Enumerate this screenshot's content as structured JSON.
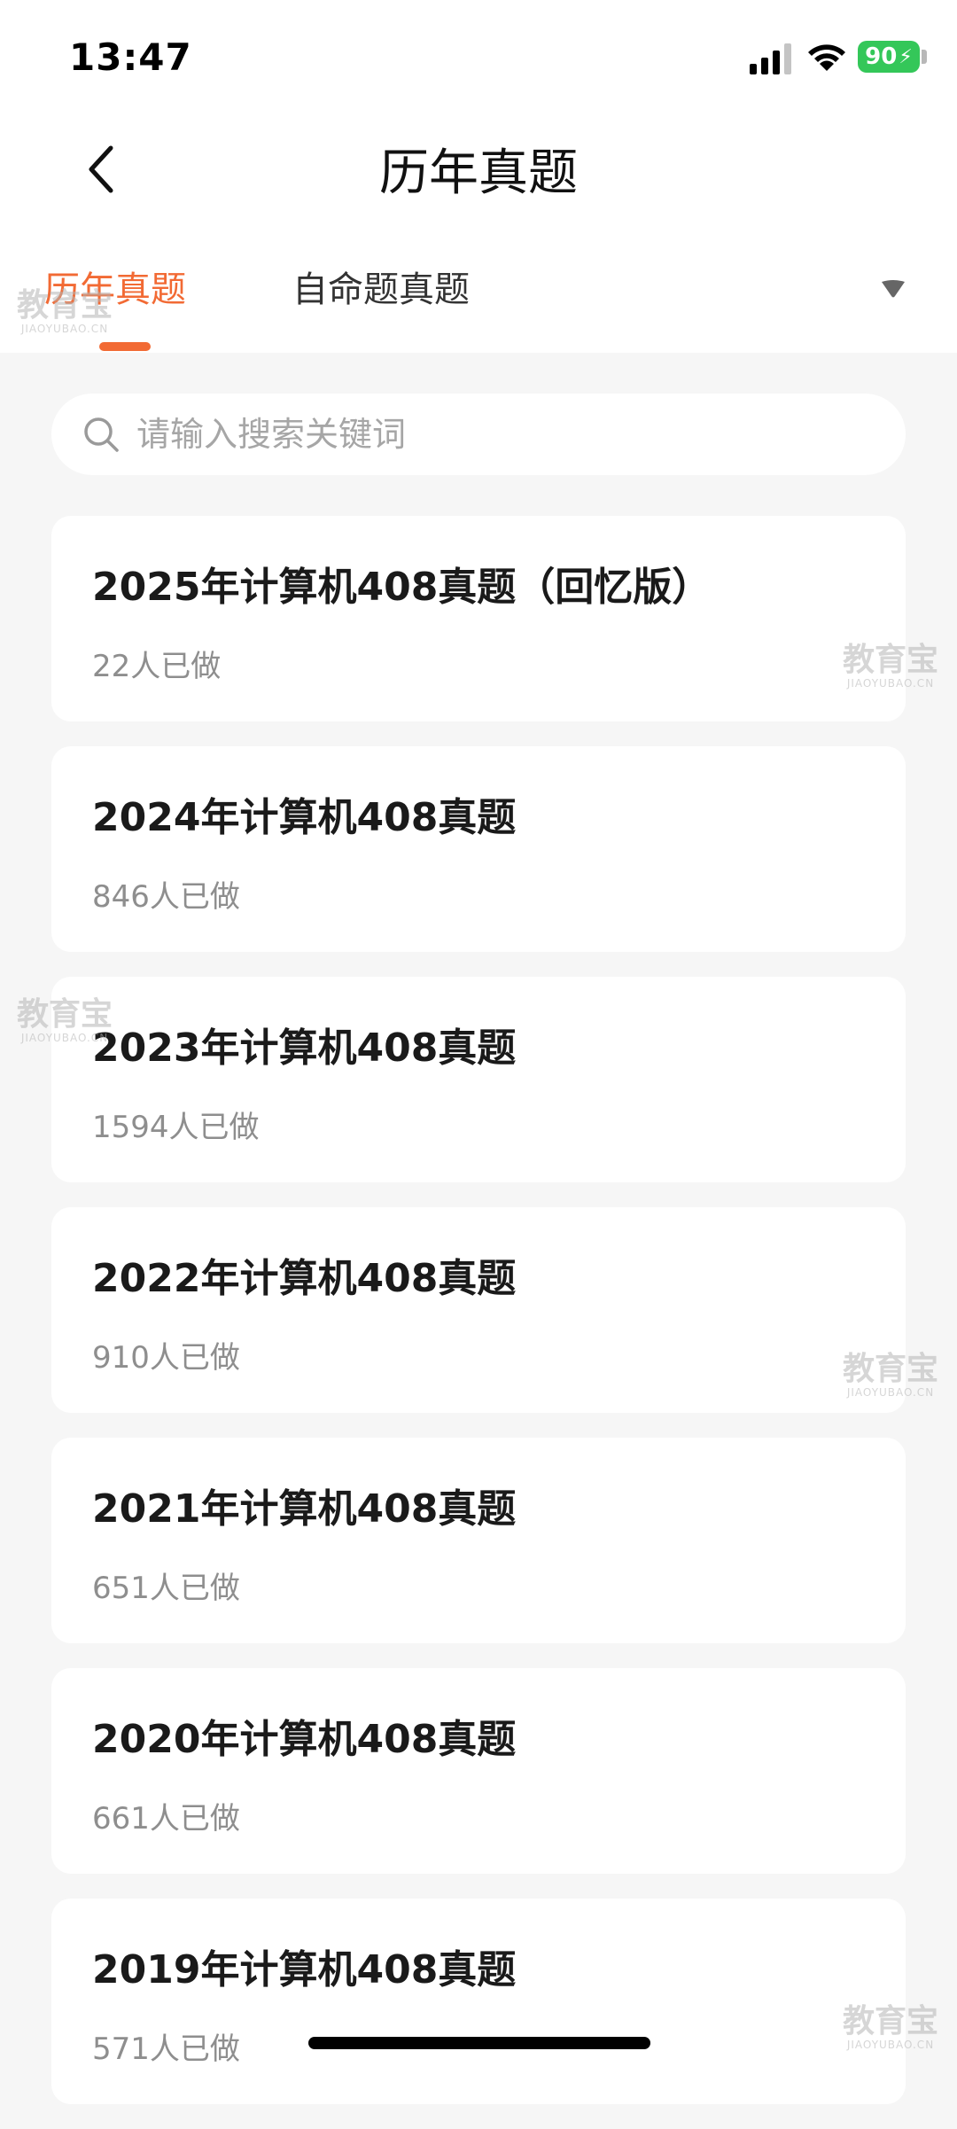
{
  "status_bar": {
    "time": "13:47",
    "battery": "90",
    "icons": [
      "signal-icon",
      "wifi-icon",
      "battery-charging-icon"
    ]
  },
  "nav": {
    "title": "历年真题",
    "back_icon": "chevron-left-icon"
  },
  "tabs": [
    {
      "label": "历年真题",
      "active": true
    },
    {
      "label": "自命题真题",
      "active": false
    }
  ],
  "tab_dropdown_icon": "caret-down-icon",
  "search": {
    "placeholder": "请输入搜索关键词",
    "icon": "search-icon"
  },
  "items": [
    {
      "title": "2025年计算机408真题（回忆版）",
      "count": "22人已做"
    },
    {
      "title": "2024年计算机408真题",
      "count": "846人已做"
    },
    {
      "title": "2023年计算机408真题",
      "count": "1594人已做"
    },
    {
      "title": "2022年计算机408真题",
      "count": "910人已做"
    },
    {
      "title": "2021年计算机408真题",
      "count": "651人已做"
    },
    {
      "title": "2020年计算机408真题",
      "count": "661人已做"
    },
    {
      "title": "2019年计算机408真题",
      "count": "571人已做"
    }
  ],
  "watermark": {
    "cn": "教育宝",
    "en": "JIAOYUBAO.CN"
  },
  "colors": {
    "accent": "#f26a34",
    "background": "#f6f6f6",
    "card": "#ffffff",
    "battery": "#34c759"
  }
}
